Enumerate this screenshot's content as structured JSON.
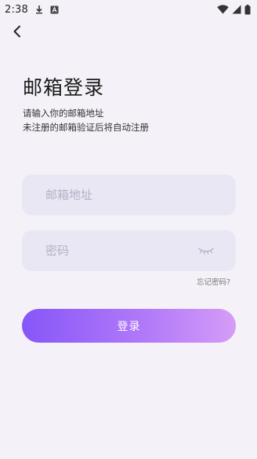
{
  "status_bar": {
    "time": "2:38",
    "icons": [
      "download-icon",
      "font-a-icon",
      "wifi-icon",
      "signal-icon",
      "battery-icon"
    ]
  },
  "header": {
    "back_icon": "chevron-left-icon"
  },
  "main": {
    "title": "邮箱登录",
    "subtitle_line1": "请输入你的邮箱地址",
    "subtitle_line2": "未注册的邮箱验证后将自动注册",
    "email_input": {
      "placeholder": "邮箱地址",
      "value": ""
    },
    "password_input": {
      "placeholder": "密码",
      "value": "",
      "toggle_icon": "eye-closed-icon"
    },
    "forgot_password": "忘记密码?",
    "login_button": "登录"
  },
  "colors": {
    "background": "#f4f2f8",
    "input_background": "#e9e7f4",
    "button_gradient_start": "#8756f8",
    "button_gradient_end": "#d59cf7"
  }
}
